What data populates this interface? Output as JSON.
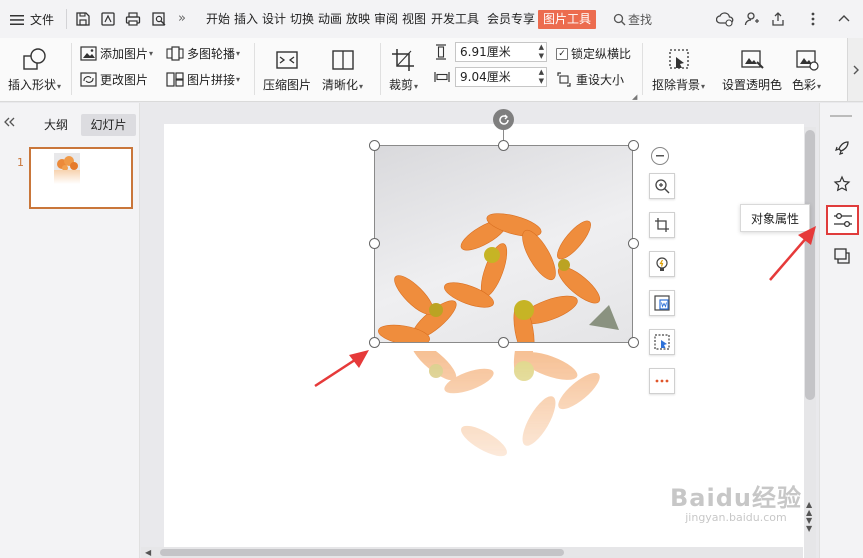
{
  "menubar": {
    "file_label": "文件",
    "tabs": [
      {
        "label": "开始"
      },
      {
        "label": "插入"
      },
      {
        "label": "设计"
      },
      {
        "label": "切换"
      },
      {
        "label": "动画"
      },
      {
        "label": "放映"
      },
      {
        "label": "审阅"
      },
      {
        "label": "视图"
      },
      {
        "label": "开发工具"
      },
      {
        "label": "会员专享"
      },
      {
        "label": "图片工具"
      }
    ],
    "search_label": "查找",
    "active_tab_color": "#ec6c4f"
  },
  "ribbon": {
    "insert_shape": "插入形状",
    "add_picture": "添加图片",
    "change_picture": "更改图片",
    "multi_carousel": "多图轮播",
    "picture_stitch": "图片拼接",
    "compress_picture": "压缩图片",
    "sharpen": "清晰化",
    "crop": "裁剪",
    "height_value": "6.91厘米",
    "width_value": "9.04厘米",
    "lock_ratio": "锁定纵横比",
    "reset_size": "重设大小",
    "remove_background": "抠除背景",
    "set_transparent": "设置透明色",
    "color": "色彩"
  },
  "leftpanel": {
    "tab_outline": "大纲",
    "tab_slides": "幻灯片",
    "slide_number": "1"
  },
  "rightbar": {
    "tooltip": "对象属性",
    "highlight_color": "#e03c3c"
  },
  "watermark": {
    "brand": "Baidu经验",
    "url": "jingyan.baidu.com"
  }
}
